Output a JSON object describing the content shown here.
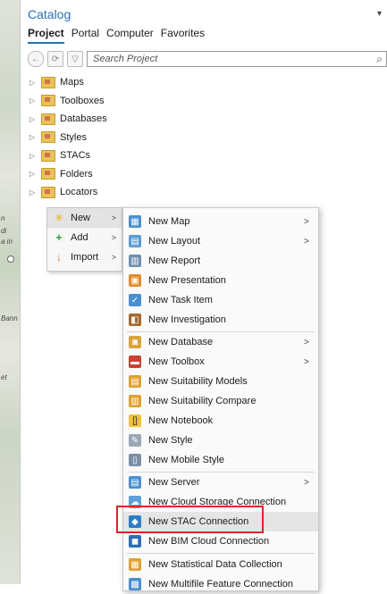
{
  "pane": {
    "title": "Catalog",
    "menu_glyph": "▾"
  },
  "tabs": [
    "Project",
    "Portal",
    "Computer",
    "Favorites"
  ],
  "search": {
    "placeholder": "Search Project"
  },
  "tree": [
    "Maps",
    "Toolboxes",
    "Databases",
    "Styles",
    "STACs",
    "Folders",
    "Locators"
  ],
  "menu1": [
    {
      "label": "New"
    },
    {
      "label": "Add"
    },
    {
      "label": "Import"
    }
  ],
  "menu2": [
    {
      "label": "New Map"
    },
    {
      "label": "New Layout"
    },
    {
      "label": "New Report"
    },
    {
      "label": "New Presentation"
    },
    {
      "label": "New Task Item"
    },
    {
      "label": "New Investigation"
    },
    {
      "label": "New Database"
    },
    {
      "label": "New Toolbox"
    },
    {
      "label": "New Suitability Models"
    },
    {
      "label": "New Suitability Compare"
    },
    {
      "label": "New Notebook"
    },
    {
      "label": "New Style"
    },
    {
      "label": "New Mobile Style"
    },
    {
      "label": "New Server"
    },
    {
      "label": "New Cloud Storage Connection"
    },
    {
      "label": "New STAC Connection"
    },
    {
      "label": "New BIM Cloud Connection"
    },
    {
      "label": "New Statistical Data Collection"
    },
    {
      "label": "New Multifile Feature Connection"
    }
  ],
  "map_labels": [
    "n",
    "di",
    "a in",
    "Bann",
    "et"
  ]
}
